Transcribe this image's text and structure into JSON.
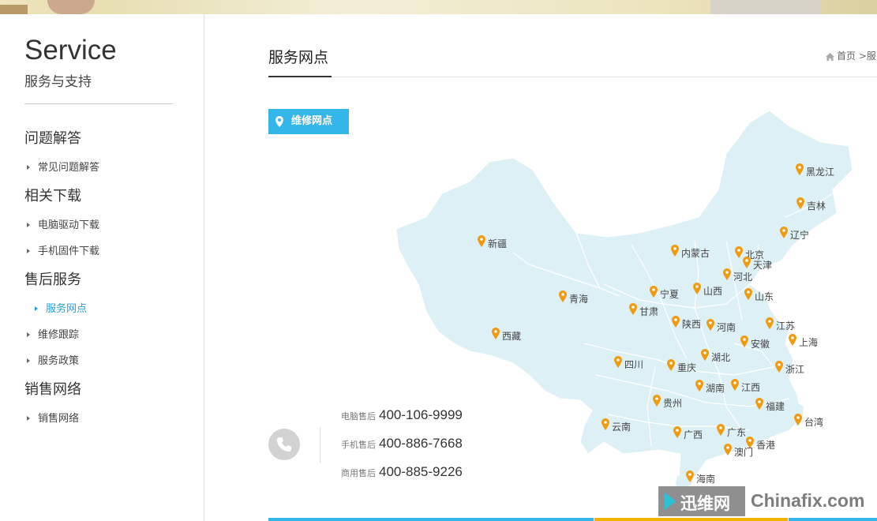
{
  "sidebar": {
    "brand_title": "Service",
    "brand_subtitle": "服务与支持",
    "sections": [
      {
        "title": "问题解答",
        "items": [
          {
            "label": "常见问题解答"
          }
        ]
      },
      {
        "title": "相关下载",
        "items": [
          {
            "label": "电脑驱动下载"
          },
          {
            "label": "手机固件下载"
          }
        ]
      },
      {
        "title": "售后服务",
        "items": [
          {
            "label": "服务网点",
            "active": true
          },
          {
            "label": "维修跟踪"
          },
          {
            "label": "服务政策"
          }
        ]
      },
      {
        "title": "销售网络",
        "items": [
          {
            "label": "销售网络"
          }
        ]
      }
    ]
  },
  "main": {
    "title": "服务网点",
    "breadcrumb": "首页 >服",
    "badge_label": "维修网点",
    "provinces": [
      "黑龙江",
      "吉林",
      "辽宁",
      "新疆",
      "内蒙古",
      "北京",
      "天津",
      "河北",
      "宁夏",
      "山西",
      "山东",
      "青海",
      "甘肃",
      "陕西",
      "河南",
      "江苏",
      "安徽",
      "上海",
      "西藏",
      "湖北",
      "四川",
      "重庆",
      "浙江",
      "湖南",
      "江西",
      "贵州",
      "福建",
      "台湾",
      "云南",
      "广西",
      "广东",
      "香港",
      "澳门",
      "海南"
    ],
    "phones": [
      {
        "label": "电脑售后",
        "number": "400-106-9999"
      },
      {
        "label": "手机售后",
        "number": "400-886-7668"
      },
      {
        "label": "商用售后",
        "number": "400-885-9226"
      }
    ]
  },
  "watermark": {
    "cn": "迅维网",
    "en": "Chinafix.com"
  },
  "colors": {
    "accent": "#35b6e8",
    "pin": "#f19a0d",
    "map_fill": "#ddf0f6",
    "bottom_bar": [
      "#35b6e8",
      "#f0b400",
      "#35b6e8"
    ]
  },
  "icons": {
    "badge": "location-pin-icon",
    "phone": "phone-icon",
    "breadcrumb": "home-icon"
  }
}
